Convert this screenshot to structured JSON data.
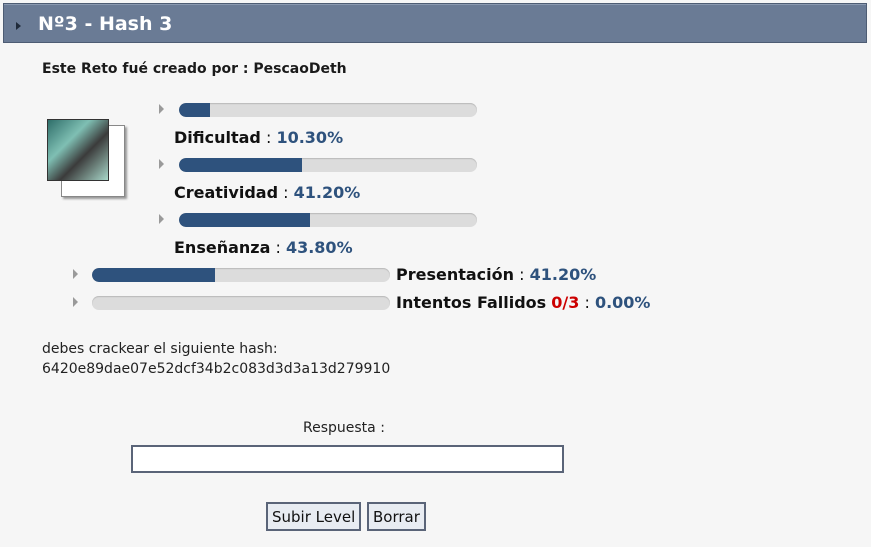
{
  "header": {
    "title": "Nº3 - Hash 3"
  },
  "creator_text": "Este Reto fué creado por : PescaoDeth",
  "stats": [
    {
      "label": "Dificultad",
      "sep": " : ",
      "value": "10.30%",
      "fill": 0.103
    },
    {
      "label": "Creatividad",
      "sep": " : ",
      "value": "41.20%",
      "fill": 0.412
    },
    {
      "label": "Enseñanza",
      "sep": " : ",
      "value": "43.80%",
      "fill": 0.438
    },
    {
      "label": "Presentación",
      "sep": " : ",
      "value": "41.20%",
      "fill": 0.412
    },
    {
      "label": "Intentos Fallidos",
      "attempts": "0/3",
      "sep": " : ",
      "value": "0.00%",
      "fill": 0.0
    }
  ],
  "instructions": "debes crackear el siguiente hash:",
  "hash": "6420e89dae07e52dcf34b2c083d3d3a13d279910",
  "form": {
    "answer_label": "Respuesta :",
    "answer_value": "",
    "submit_label": "Subir Level",
    "reset_label": "Borrar"
  },
  "colors": {
    "header_bg": "#6a7b95",
    "bar_fill": "#2e527d",
    "bar_bg": "#dcdcdc",
    "fail": "#cc0000"
  }
}
